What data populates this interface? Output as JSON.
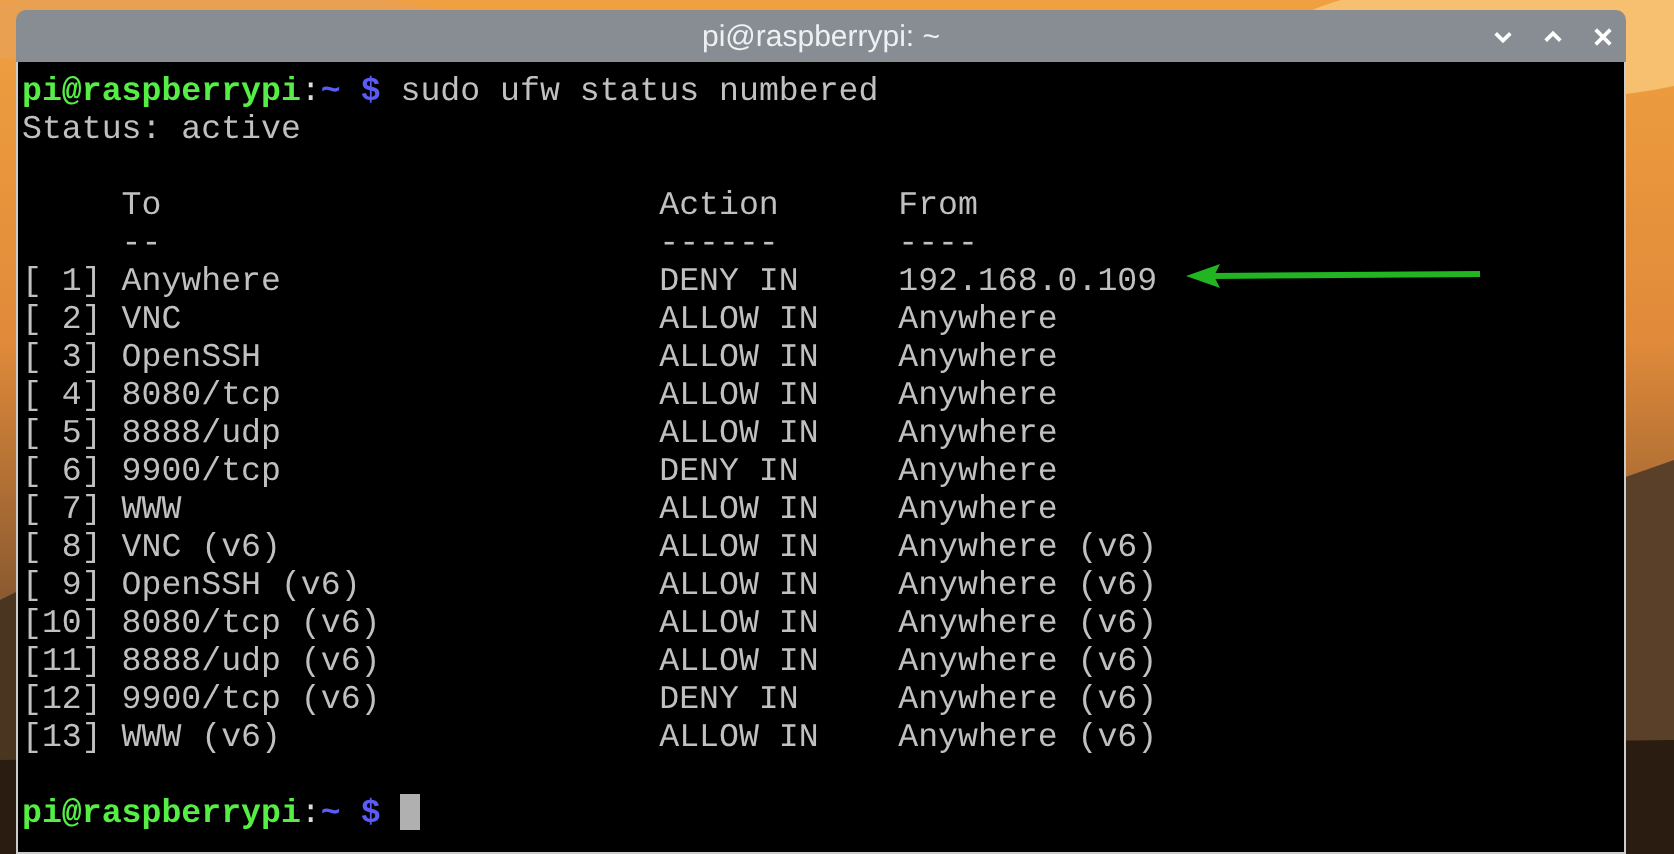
{
  "window": {
    "title": "pi@raspberrypi: ~"
  },
  "command_line": {
    "user_host": "pi@raspberrypi",
    "separator": ":",
    "path": "~",
    "prompt": "$",
    "command": "sudo ufw status numbered"
  },
  "status_line": "Status: active",
  "table": {
    "columns": [
      "To",
      "Action",
      "From"
    ],
    "underlines": [
      "--",
      "------",
      "----"
    ],
    "rows": [
      {
        "number": "[ 1]",
        "to": "Anywhere",
        "action": "DENY IN",
        "from": "192.168.0.109"
      },
      {
        "number": "[ 2]",
        "to": "VNC",
        "action": "ALLOW IN",
        "from": "Anywhere"
      },
      {
        "number": "[ 3]",
        "to": "OpenSSH",
        "action": "ALLOW IN",
        "from": "Anywhere"
      },
      {
        "number": "[ 4]",
        "to": "8080/tcp",
        "action": "ALLOW IN",
        "from": "Anywhere"
      },
      {
        "number": "[ 5]",
        "to": "8888/udp",
        "action": "ALLOW IN",
        "from": "Anywhere"
      },
      {
        "number": "[ 6]",
        "to": "9900/tcp",
        "action": "DENY IN",
        "from": "Anywhere"
      },
      {
        "number": "[ 7]",
        "to": "WWW",
        "action": "ALLOW IN",
        "from": "Anywhere"
      },
      {
        "number": "[ 8]",
        "to": "VNC (v6)",
        "action": "ALLOW IN",
        "from": "Anywhere (v6)"
      },
      {
        "number": "[ 9]",
        "to": "OpenSSH (v6)",
        "action": "ALLOW IN",
        "from": "Anywhere (v6)"
      },
      {
        "number": "[10]",
        "to": "8080/tcp (v6)",
        "action": "ALLOW IN",
        "from": "Anywhere (v6)"
      },
      {
        "number": "[11]",
        "to": "8888/udp (v6)",
        "action": "ALLOW IN",
        "from": "Anywhere (v6)"
      },
      {
        "number": "[12]",
        "to": "9900/tcp (v6)",
        "action": "DENY IN",
        "from": "Anywhere (v6)"
      },
      {
        "number": "[13]",
        "to": "WWW (v6)",
        "action": "ALLOW IN",
        "from": "Anywhere (v6)"
      }
    ]
  },
  "final_prompt": {
    "user_host": "pi@raspberrypi",
    "separator": ":",
    "path": "~",
    "prompt": "$"
  }
}
